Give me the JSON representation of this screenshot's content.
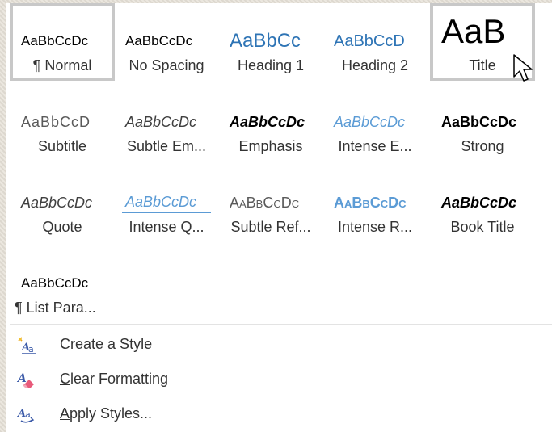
{
  "styles": [
    {
      "preview": "AaBbCcDc",
      "label": "¶ Normal"
    },
    {
      "preview": "AaBbCcDc",
      "label": "No Spacing"
    },
    {
      "preview": "AaBbCc",
      "label": "Heading 1"
    },
    {
      "preview": "AaBbCcD",
      "label": "Heading 2"
    },
    {
      "preview": "AaB",
      "label": "Title"
    },
    {
      "preview": "AaBbCcD",
      "label": "Subtitle"
    },
    {
      "preview": "AaBbCcDc",
      "label": "Subtle Em..."
    },
    {
      "preview": "AaBbCcDc",
      "label": "Emphasis"
    },
    {
      "preview": "AaBbCcDc",
      "label": "Intense E..."
    },
    {
      "preview": "AaBbCcDc",
      "label": "Strong"
    },
    {
      "preview": "AaBbCcDc",
      "label": "Quote"
    },
    {
      "preview": "AaBbCcDc",
      "label": "Intense Q..."
    },
    {
      "preview": "AaBbCcDc",
      "label": "Subtle Ref..."
    },
    {
      "preview": "AaBbCcDc",
      "label": "Intense R..."
    },
    {
      "preview": "AaBbCcDc",
      "label": "Book Title"
    },
    {
      "preview": "AaBbCcDc",
      "label": "¶ List Para..."
    }
  ],
  "commands": {
    "create": {
      "pre": "Create a ",
      "u": "S",
      "post": "tyle"
    },
    "clear": {
      "pre": "",
      "u": "C",
      "post": "lear Formatting"
    },
    "apply": {
      "pre": "",
      "u": "A",
      "post": "pply Styles..."
    }
  },
  "colors": {
    "accent": "#2e74b5",
    "selected_border": "#c8c8c8"
  }
}
